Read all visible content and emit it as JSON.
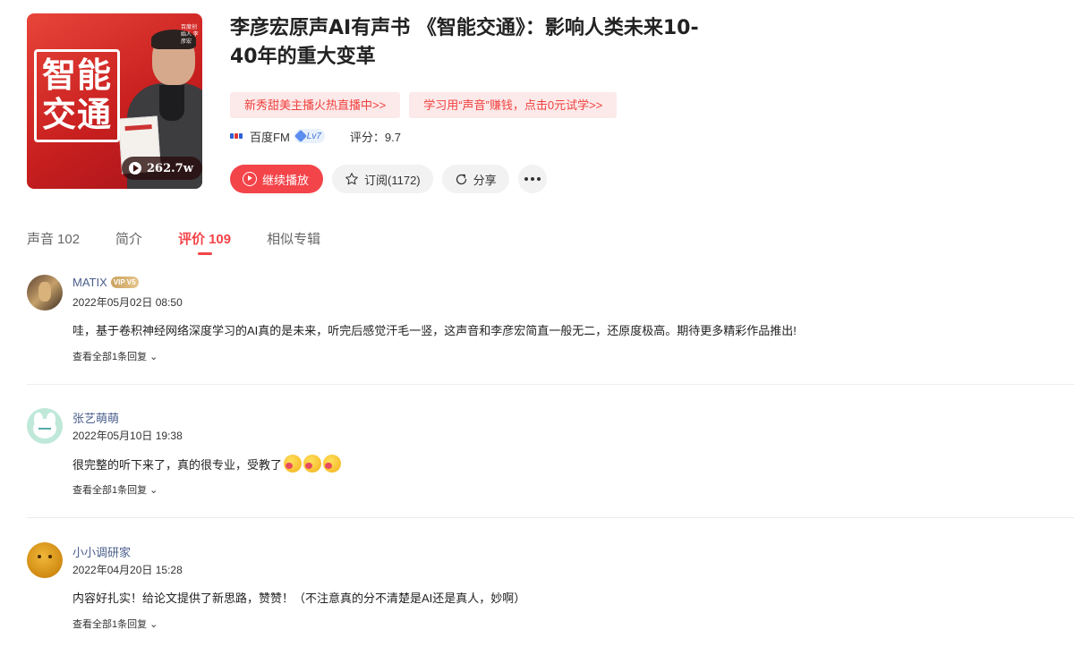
{
  "album": {
    "cover_text": "智能交通",
    "cover_small_text": "百度创始人 李彦宏",
    "play_count": "262.7w",
    "title": "李彦宏原声AI有声书 《智能交通》：影响人类未来10-40年的重大变革",
    "promos": [
      "新秀甜美主播火热直播中>>",
      "学习用“声音”赚钱，点击0元试学>>"
    ],
    "brand": "百度FM",
    "level": "Lv7",
    "score": "评分：9.7"
  },
  "actions": {
    "play": "继续播放",
    "subscribe": "订阅(1172)",
    "share": "分享"
  },
  "tabs": [
    {
      "label": "声音",
      "count": "102"
    },
    {
      "label": "简介",
      "count": ""
    },
    {
      "label": "评价",
      "count": "109"
    },
    {
      "label": "相似专辑",
      "count": ""
    }
  ],
  "comments": [
    {
      "user": "MATIX",
      "vip": "VIP V5",
      "time": "2022年05月02日 08:50",
      "content": "哇，基于卷积神经网络深度学习的AI真的是未来，听完后感觉汗毛一竖，这声音和李彦宏简直一般无二，还原度极高。期待更多精彩作品推出!",
      "replies": "查看全部1条回复 ⌄"
    },
    {
      "user": "张艺萌萌",
      "time": "2022年05月10日 19:38",
      "content": "很完整的听下来了，真的很专业，受教了",
      "replies": "查看全部1条回复 ⌄"
    },
    {
      "user": "小小调研家",
      "time": "2022年04月20日 15:28",
      "content": "内容好扎实！给论文提供了新思路，赞赞！（不注意真的分不清楚是AI还是真人，妙啊）",
      "replies": "查看全部1条回复 ⌄"
    }
  ]
}
